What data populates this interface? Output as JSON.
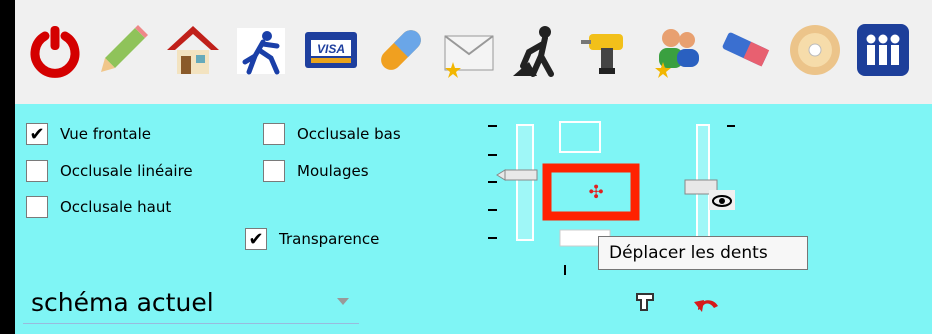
{
  "toolbar": {
    "icons": [
      "power-icon",
      "pencil-icon",
      "home-icon",
      "running-figure-icon",
      "visa-card-icon",
      "capsule-icon",
      "envelope-star-icon",
      "digging-worker-icon",
      "drill-icon",
      "users-star-icon",
      "eraser-icon",
      "cd-disc-icon",
      "people-icon"
    ],
    "visa_label": "VISA"
  },
  "checkboxes": {
    "vue_frontale": {
      "label": "Vue frontale",
      "checked": true
    },
    "occlusale_lineaire": {
      "label": "Occlusale linéaire",
      "checked": false
    },
    "occlusale_haut": {
      "label": "Occlusale haut",
      "checked": false
    },
    "occlusale_bas": {
      "label": "Occlusale bas",
      "checked": false
    },
    "moulages": {
      "label": "Moulages",
      "checked": false
    },
    "transparence": {
      "label": "Transparence",
      "checked": true
    }
  },
  "check_mark": "✔",
  "combo": {
    "value": "schéma actuel"
  },
  "tooltip": {
    "text": "Déplacer les dents"
  },
  "move_glyph": "✣",
  "colors": {
    "panel": "#7ff5f5",
    "highlight": "#ff2200",
    "power": "#d40000"
  }
}
